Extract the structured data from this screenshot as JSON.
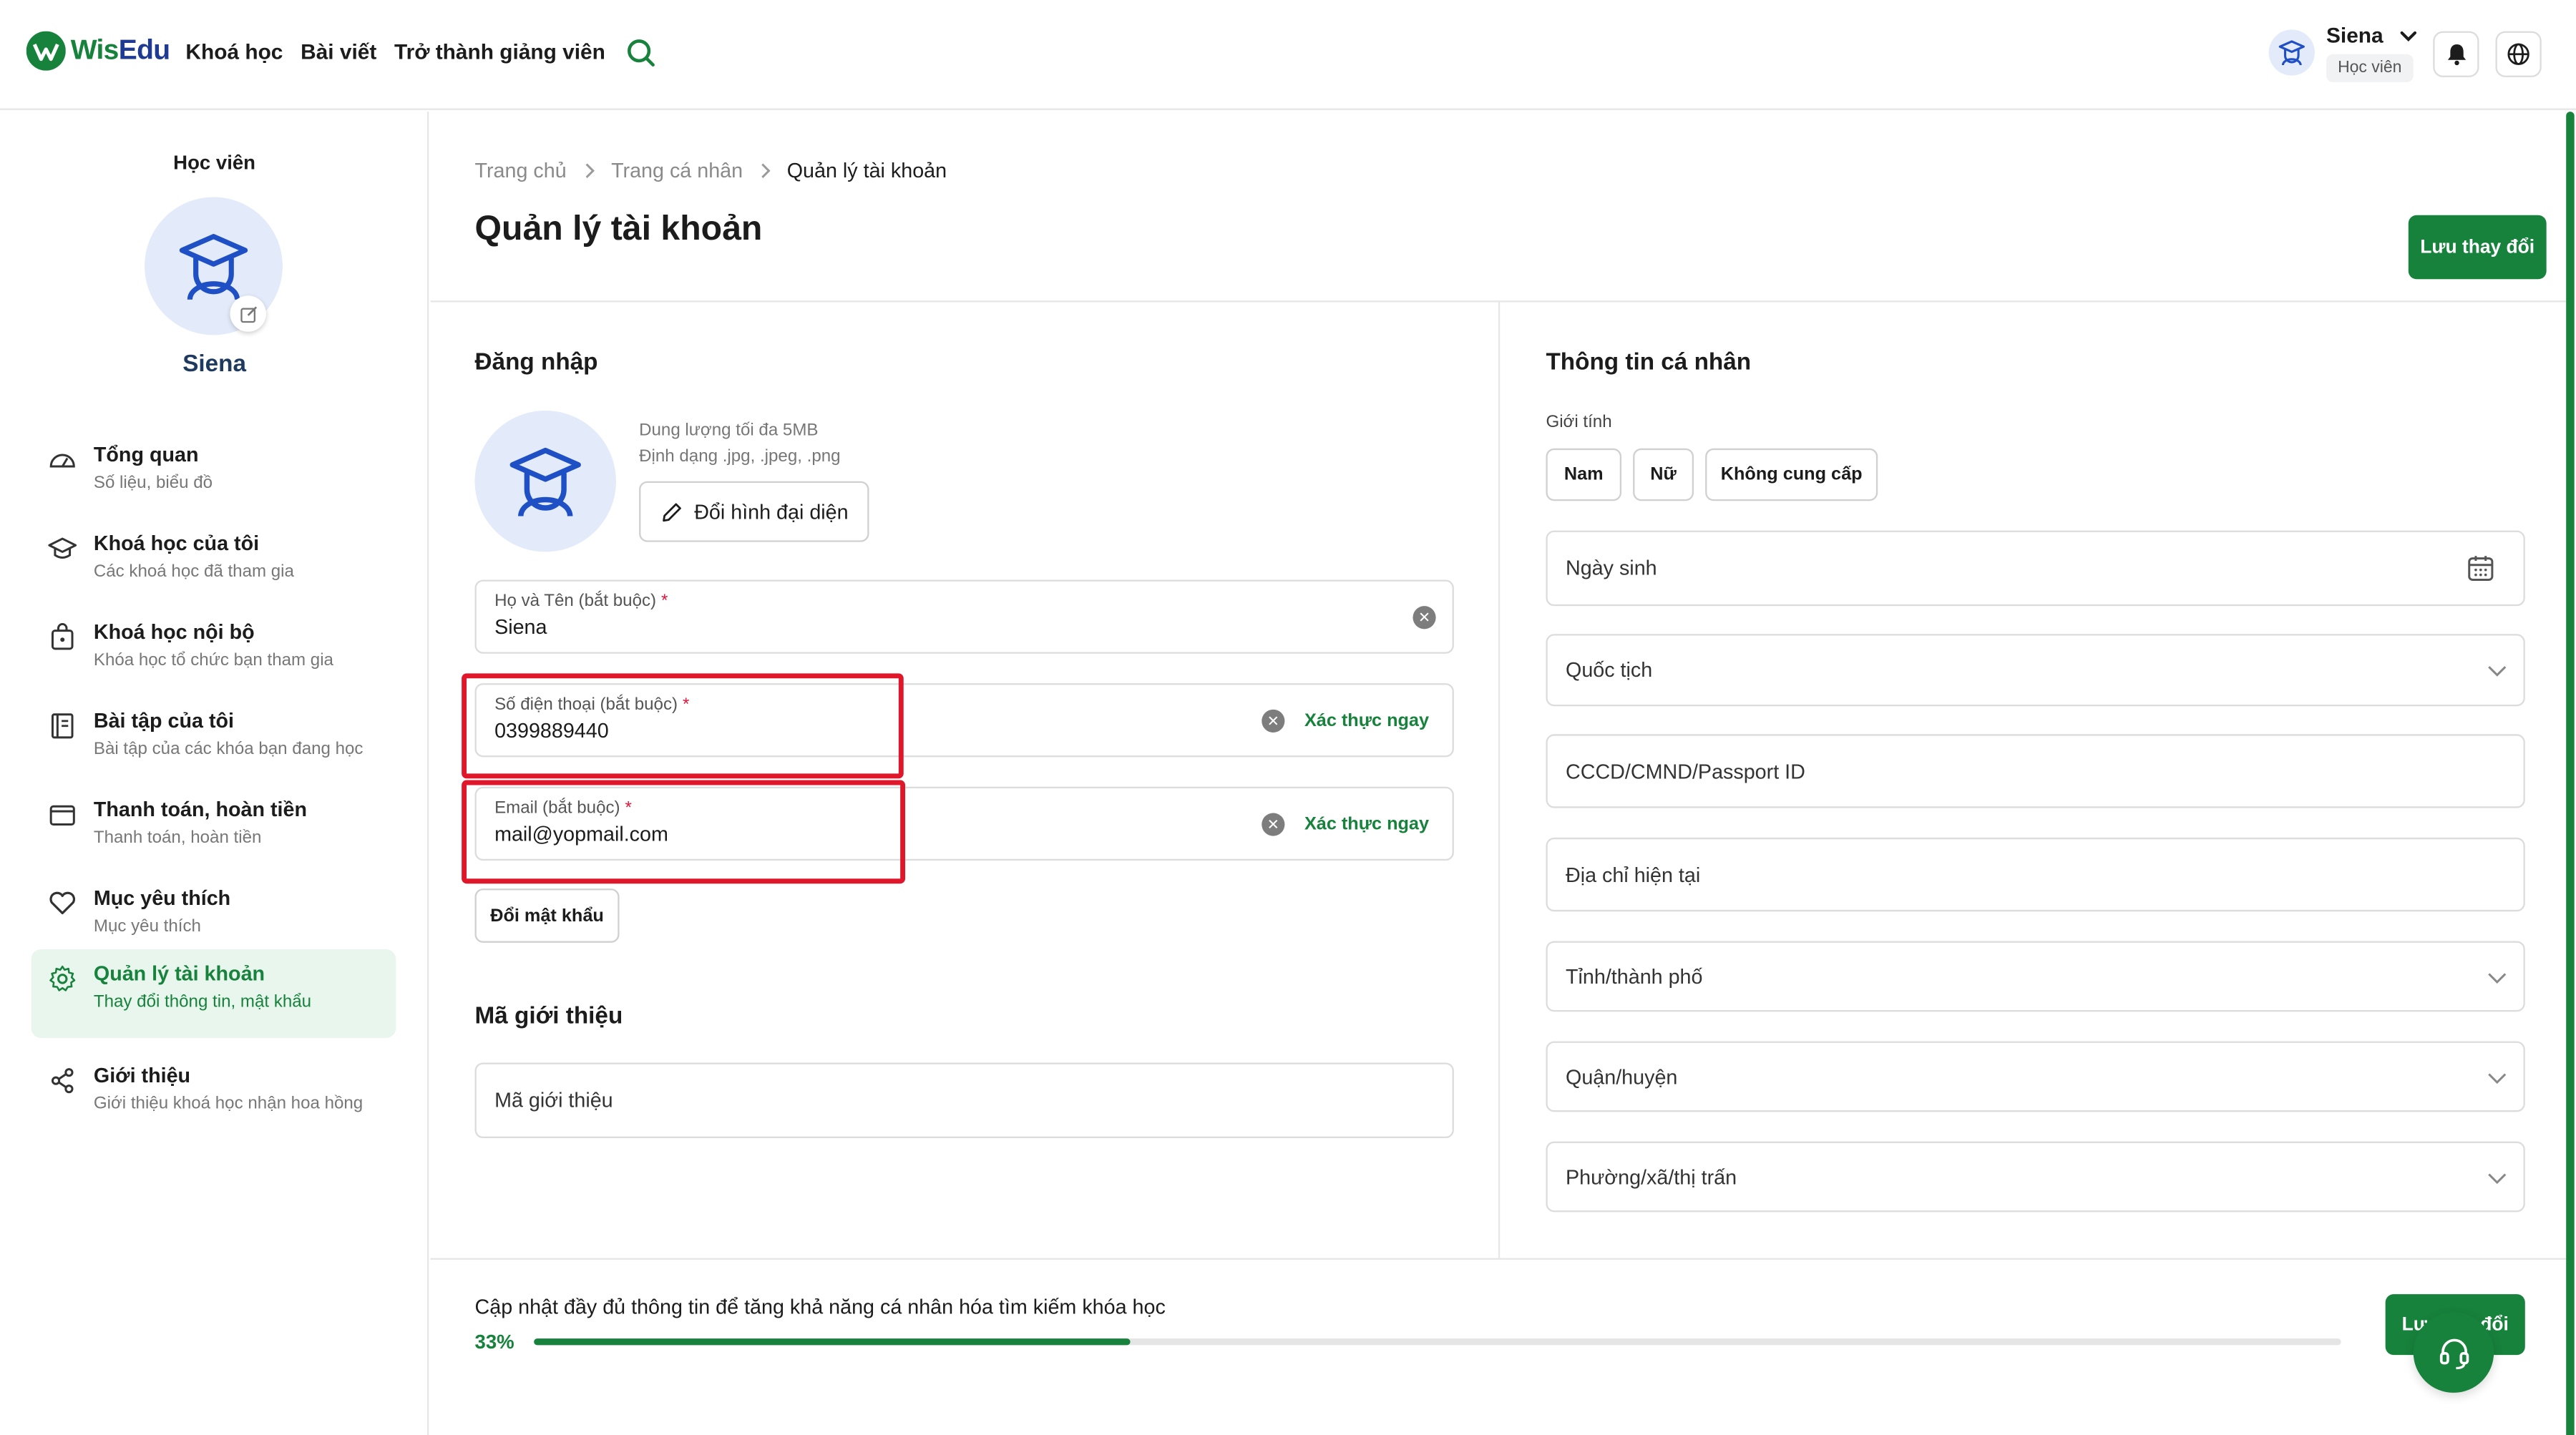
{
  "brand": {
    "name_part1": "Wis",
    "name_part2": "Edu"
  },
  "nav": {
    "courses": "Khoá học",
    "posts": "Bài viết",
    "become_instructor": "Trở thành giảng viên"
  },
  "user": {
    "name": "Siena",
    "role": "Học viên"
  },
  "sidebar": {
    "role_label": "Học viên",
    "profile_name": "Siena",
    "items": [
      {
        "title": "Tổng quan",
        "sub": "Số liệu, biểu đồ",
        "icon": "dashboard-icon"
      },
      {
        "title": "Khoá học của tôi",
        "sub": "Các khoá học đã tham gia",
        "icon": "graduation-cap-icon"
      },
      {
        "title": "Khoá học nội bộ",
        "sub": "Khóa học tổ chức bạn tham gia",
        "icon": "lock-bag-icon"
      },
      {
        "title": "Bài tập của tôi",
        "sub": "Bài tập của các khóa bạn đang học",
        "icon": "assignment-icon"
      },
      {
        "title": "Thanh toán, hoàn tiền",
        "sub": "Thanh toán, hoàn tiền",
        "icon": "wallet-icon"
      },
      {
        "title": "Mục yêu thích",
        "sub": "Mục yêu thích",
        "icon": "heart-icon"
      },
      {
        "title": "Quản lý tài khoản",
        "sub": "Thay đổi thông tin, mật khẩu",
        "icon": "gear-icon",
        "active": true
      },
      {
        "title": "Giới thiệu",
        "sub": "Giới thiệu khoá học nhận hoa hồng",
        "icon": "share-icon"
      }
    ]
  },
  "breadcrumb": {
    "home": "Trang chủ",
    "profile": "Trang cá nhân",
    "current": "Quản lý tài khoản"
  },
  "page": {
    "title": "Quản lý tài khoản",
    "save_label": "Lưu thay đổi"
  },
  "login": {
    "section_title": "Đăng nhập",
    "size_note": "Dung lượng tối đa 5MB",
    "format_note": "Định dạng .jpg, .jpeg, .png",
    "change_avatar_label": "Đổi hình đại diện",
    "name_label": "Họ và Tên (bắt buộc)",
    "name_value": "Siena",
    "phone_label": "Số điện thoại (bắt buộc)",
    "phone_value": "0399889440",
    "email_label": "Email (bắt buộc)",
    "email_value": "mail@yopmail.com",
    "verify_label": "Xác thực ngay",
    "change_password_label": "Đổi mật khẩu",
    "required_mark": "*"
  },
  "referral": {
    "section_title": "Mã giới thiệu",
    "placeholder": "Mã giới thiệu"
  },
  "personal": {
    "section_title": "Thông tin cá nhân",
    "gender_label": "Giới tính",
    "gender_options": [
      "Nam",
      "Nữ",
      "Không cung cấp"
    ],
    "dob_placeholder": "Ngày sinh",
    "nationality_placeholder": "Quốc tịch",
    "id_placeholder": "CCCD/CMND/Passport ID",
    "address_placeholder": "Địa chỉ hiện tại",
    "province_placeholder": "Tỉnh/thành phố",
    "district_placeholder": "Quận/huyện",
    "ward_placeholder": "Phường/xã/thị trấn"
  },
  "footer": {
    "progress_text": "Cập nhật đầy đủ thông tin để tăng khả năng cá nhân hóa tìm kiếm khóa học",
    "progress_percent_label": "33%",
    "progress_value": 0.33,
    "save_label_partial_left": "Lư",
    "save_label_partial_right": "đổi"
  },
  "colors": {
    "brand_green": "#17823c",
    "highlight_red": "#e0162b",
    "avatar_bg": "#e3ebfa",
    "active_bg": "#e8f6ee"
  }
}
